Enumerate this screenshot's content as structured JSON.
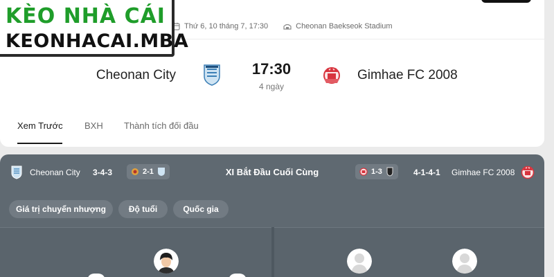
{
  "header": {
    "date_time": "Thứ 6, 10 tháng 7, 17:30",
    "venue": "Cheonan Baekseok Stadium",
    "home_team": "Cheonan City",
    "away_team": "Gimhae FC 2008",
    "kickoff_time": "17:30",
    "countdown": "4 ngày"
  },
  "tabs": [
    {
      "label": "Xem Trước",
      "active": true
    },
    {
      "label": "BXH",
      "active": false
    },
    {
      "label": "Thành tích đối đầu",
      "active": false
    }
  ],
  "logo": {
    "line1": "KÈO NHÀ CÁI",
    "line2": "KEONHACAI.MBA"
  },
  "lineup": {
    "home_name": "Cheonan City",
    "home_formation": "3-4-3",
    "home_last_result": "2-1",
    "title": "XI Bắt Đầu Cuối Cùng",
    "away_last_result": "1-3",
    "away_formation": "4-1-4-1",
    "away_name": "Gimhae FC 2008",
    "filters": [
      "Giá trị chuyển nhượng",
      "Độ tuổi",
      "Quốc gia"
    ]
  },
  "colors": {
    "brand_green": "#1f9d2a",
    "home_blue": "#5aa6d8",
    "away_red": "#d8343e",
    "panel": "#5f6971"
  },
  "icons": {
    "calendar": "calendar-icon",
    "stadium": "stadium-icon"
  }
}
